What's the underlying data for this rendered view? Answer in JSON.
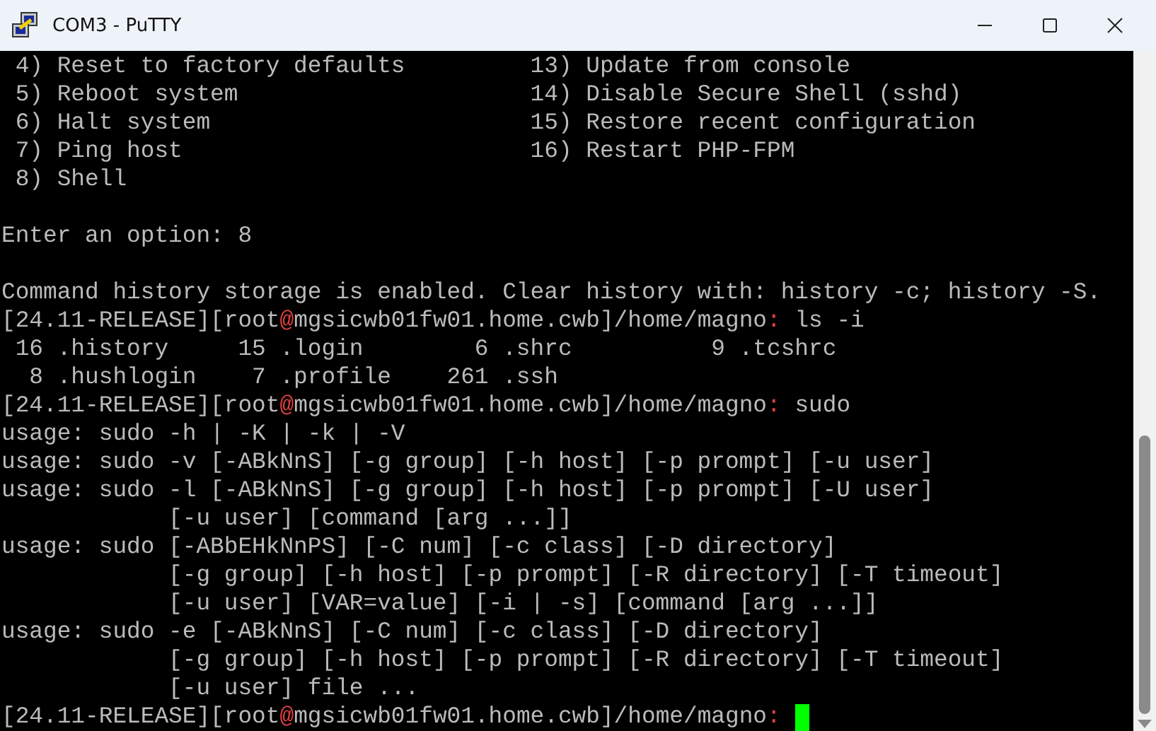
{
  "window": {
    "title": "COM3 - PuTTY"
  },
  "terminal": {
    "lines": [
      {
        "kind": "text",
        "segments": [
          {
            "kind": "plain",
            "text": " 4) Reset to factory defaults         13) Update from console"
          }
        ]
      },
      {
        "kind": "text",
        "segments": [
          {
            "kind": "plain",
            "text": " 5) Reboot system                     14) Disable Secure Shell (sshd)"
          }
        ]
      },
      {
        "kind": "text",
        "segments": [
          {
            "kind": "plain",
            "text": " 6) Halt system                       15) Restore recent configuration"
          }
        ]
      },
      {
        "kind": "text",
        "segments": [
          {
            "kind": "plain",
            "text": " 7) Ping host                         16) Restart PHP-FPM"
          }
        ]
      },
      {
        "kind": "text",
        "segments": [
          {
            "kind": "plain",
            "text": " 8) Shell"
          }
        ]
      },
      {
        "kind": "blank"
      },
      {
        "kind": "text",
        "segments": [
          {
            "kind": "plain",
            "text": "Enter an option: 8"
          }
        ]
      },
      {
        "kind": "blank"
      },
      {
        "kind": "text",
        "segments": [
          {
            "kind": "plain",
            "text": "Command history storage is enabled. Clear history with: history -c; history -S."
          }
        ]
      },
      {
        "kind": "text",
        "segments": [
          {
            "kind": "plain",
            "text": "[24.11-RELEASE][root"
          },
          {
            "kind": "accent",
            "text": "@"
          },
          {
            "kind": "plain",
            "text": "mgsicwb01fw01.home.cwb]/home/magno"
          },
          {
            "kind": "accent",
            "text": ": "
          },
          {
            "kind": "plain",
            "text": "ls -i"
          }
        ]
      },
      {
        "kind": "text",
        "segments": [
          {
            "kind": "plain",
            "text": " 16 .history     15 .login        6 .shrc          9 .tcshrc"
          }
        ]
      },
      {
        "kind": "text",
        "segments": [
          {
            "kind": "plain",
            "text": "  8 .hushlogin    7 .profile    261 .ssh"
          }
        ]
      },
      {
        "kind": "text",
        "segments": [
          {
            "kind": "plain",
            "text": "[24.11-RELEASE][root"
          },
          {
            "kind": "accent",
            "text": "@"
          },
          {
            "kind": "plain",
            "text": "mgsicwb01fw01.home.cwb]/home/magno"
          },
          {
            "kind": "accent",
            "text": ": "
          },
          {
            "kind": "plain",
            "text": "sudo"
          }
        ]
      },
      {
        "kind": "text",
        "segments": [
          {
            "kind": "plain",
            "text": "usage: sudo -h | -K | -k | -V"
          }
        ]
      },
      {
        "kind": "text",
        "segments": [
          {
            "kind": "plain",
            "text": "usage: sudo -v [-ABkNnS] [-g group] [-h host] [-p prompt] [-u user]"
          }
        ]
      },
      {
        "kind": "text",
        "segments": [
          {
            "kind": "plain",
            "text": "usage: sudo -l [-ABkNnS] [-g group] [-h host] [-p prompt] [-U user]"
          }
        ]
      },
      {
        "kind": "text",
        "segments": [
          {
            "kind": "plain",
            "text": "            [-u user] [command [arg ...]]"
          }
        ]
      },
      {
        "kind": "text",
        "segments": [
          {
            "kind": "plain",
            "text": "usage: sudo [-ABbEHkNnPS] [-C num] [-c class] [-D directory]"
          }
        ]
      },
      {
        "kind": "text",
        "segments": [
          {
            "kind": "plain",
            "text": "            [-g group] [-h host] [-p prompt] [-R directory] [-T timeout]"
          }
        ]
      },
      {
        "kind": "text",
        "segments": [
          {
            "kind": "plain",
            "text": "            [-u user] [VAR=value] [-i | -s] [command [arg ...]]"
          }
        ]
      },
      {
        "kind": "text",
        "segments": [
          {
            "kind": "plain",
            "text": "usage: sudo -e [-ABkNnS] [-C num] [-c class] [-D directory]"
          }
        ]
      },
      {
        "kind": "text",
        "segments": [
          {
            "kind": "plain",
            "text": "            [-g group] [-h host] [-p prompt] [-R directory] [-T timeout]"
          }
        ]
      },
      {
        "kind": "text",
        "segments": [
          {
            "kind": "plain",
            "text": "            [-u user] file ..."
          }
        ]
      },
      {
        "kind": "text",
        "cursor": true,
        "segments": [
          {
            "kind": "plain",
            "text": "[24.11-RELEASE][root"
          },
          {
            "kind": "accent",
            "text": "@"
          },
          {
            "kind": "plain",
            "text": "mgsicwb01fw01.home.cwb]/home/magno"
          },
          {
            "kind": "accent",
            "text": ": "
          }
        ]
      }
    ]
  }
}
